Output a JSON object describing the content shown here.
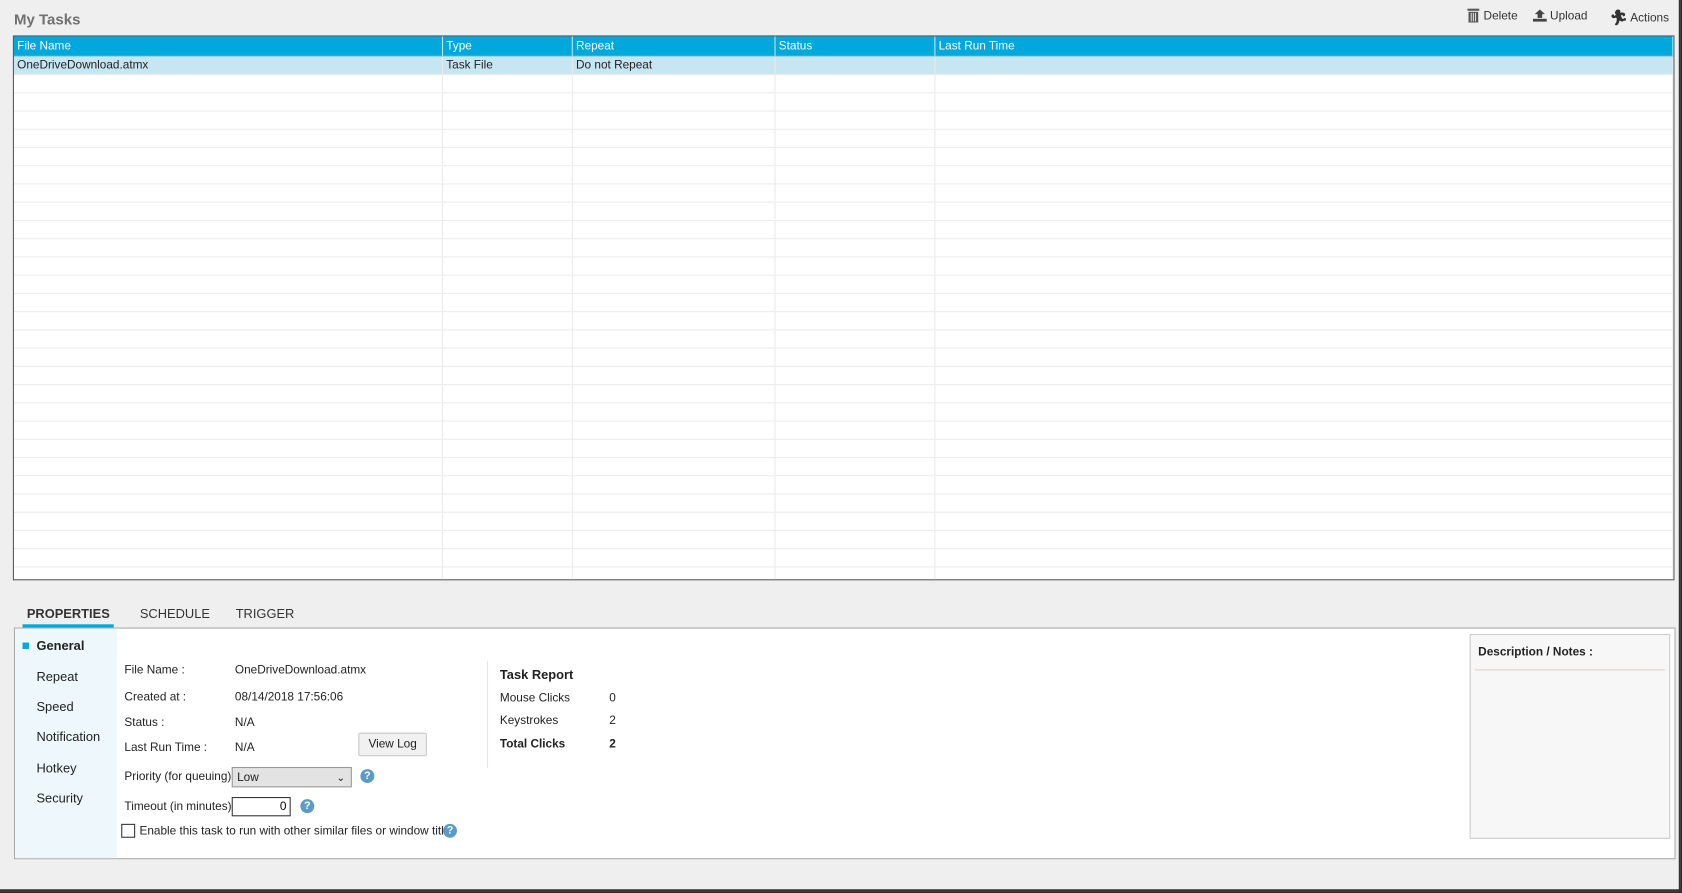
{
  "title": "My Tasks",
  "toolbar": {
    "delete": "Delete",
    "upload": "Upload",
    "actions": "Actions"
  },
  "table": {
    "columns": [
      "File Name",
      "Type",
      "Repeat",
      "Status",
      "Last Run Time"
    ],
    "rows": [
      {
        "file": "OneDriveDownload.atmx",
        "type": "Task File",
        "repeat": "Do not Repeat",
        "status": "",
        "last_run": ""
      }
    ]
  },
  "tabs": [
    "PROPERTIES",
    "SCHEDULE",
    "TRIGGER"
  ],
  "nav": [
    "General",
    "Repeat",
    "Speed",
    "Notification",
    "Hotkey",
    "Security"
  ],
  "general": {
    "file_name_label": "File Name :",
    "file_name": "OneDriveDownload.atmx",
    "created_label": "Created at :",
    "created": "08/14/2018 17:56:06",
    "status_label": "Status :",
    "status": "N/A",
    "last_run_label": "Last Run Time :",
    "last_run": "N/A",
    "view_log": "View Log",
    "priority_label": "Priority (for queuing) :",
    "priority": "Low",
    "timeout_label": "Timeout (in minutes) :",
    "timeout": "0",
    "enable_label": "Enable this task to run with other similar files or window titles",
    "help": "?"
  },
  "report": {
    "title": "Task Report",
    "mouse_label": "Mouse Clicks",
    "mouse": "0",
    "keys_label": "Keystrokes",
    "keys": "2",
    "total_label": "Total Clicks",
    "total": "2"
  },
  "notes": {
    "title": "Description / Notes :"
  },
  "colors": {
    "accent": "#00a8dc",
    "selected_row": "#c6e6f1"
  }
}
